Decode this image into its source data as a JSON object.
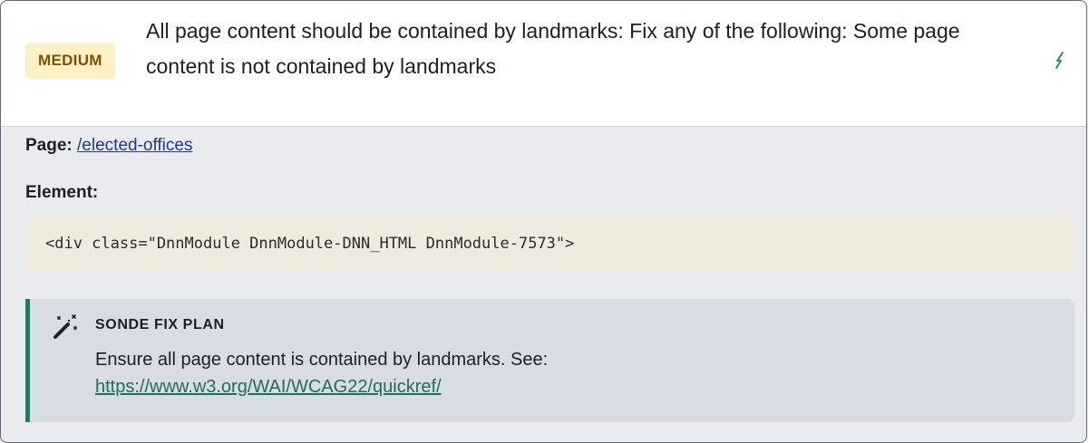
{
  "issue": {
    "severity": "MEDIUM",
    "title": "All page content should be contained by landmarks: Fix any of the following: Some page content is not contained by landmarks",
    "colors": {
      "severity_bg": "#fdf0c4",
      "severity_text": "#7a5300",
      "fix_accent": "#1f7a66"
    }
  },
  "details": {
    "page_label": "Page:",
    "page_link": "/elected-offices",
    "element_label": "Element:",
    "element_code": "<div class=\"DnnModule DnnModule-DNN_HTML DnnModule-7573\">"
  },
  "fix_plan": {
    "icon": "magic-wand-icon",
    "title": "SONDE FIX PLAN",
    "text": "Ensure all page content is contained by landmarks. See:",
    "link": "https://www.w3.org/WAI/WCAG22/quickref/"
  },
  "toggle_icon": "lightning-icon"
}
